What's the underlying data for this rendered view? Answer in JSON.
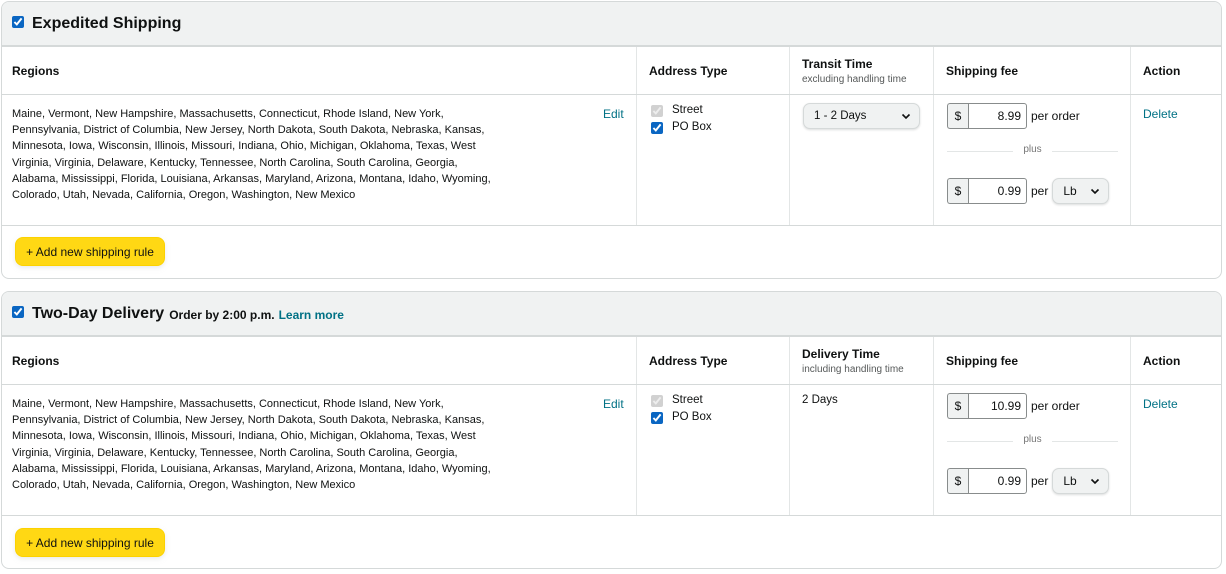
{
  "sections": [
    {
      "title": "Expedited Shipping",
      "subtitle": "",
      "link": "",
      "enabled": true,
      "headers": {
        "regions": "Regions",
        "address_type": "Address Type",
        "time": "Transit Time",
        "time_sub": "excluding handling time",
        "fee": "Shipping fee",
        "action": "Action"
      },
      "row": {
        "regions": "Maine, Vermont, New Hampshire, Massachusetts, Connecticut, Rhode Island, New York, Pennsylvania, District of Columbia, New Jersey, North Dakota, South Dakota, Nebraska, Kansas, Minnesota, Iowa, Wisconsin, Illinois, Missouri, Indiana, Ohio, Michigan, Oklahoma, Texas, West Virginia, Virginia, Delaware, Kentucky, Tennessee, North Carolina, South Carolina, Georgia, Alabama, Mississippi, Florida, Louisiana, Arkansas, Maryland, Arizona, Montana, Idaho, Wyoming, Colorado, Utah, Nevada, California, Oregon, Washington, New Mexico",
        "edit": "Edit",
        "street": "Street",
        "street_checked": true,
        "street_disabled": true,
        "po_box": "PO Box",
        "po_box_checked": true,
        "time_value": "1 - 2 Days",
        "currency": "$",
        "per_order_fee": "8.99",
        "per_order": "per order",
        "plus": "plus",
        "per_unit_fee": "0.99",
        "per": "per",
        "unit": "Lb",
        "delete": "Delete"
      },
      "add_rule": "+ Add new shipping rule"
    },
    {
      "title": "Two-Day Delivery",
      "subtitle": "Order by 2:00 p.m.",
      "link": "Learn more",
      "enabled": true,
      "headers": {
        "regions": "Regions",
        "address_type": "Address Type",
        "time": "Delivery Time",
        "time_sub": "including handling time",
        "fee": "Shipping fee",
        "action": "Action"
      },
      "row": {
        "regions": "Maine, Vermont, New Hampshire, Massachusetts, Connecticut, Rhode Island, New York, Pennsylvania, District of Columbia, New Jersey, North Dakota, South Dakota, Nebraska, Kansas, Minnesota, Iowa, Wisconsin, Illinois, Missouri, Indiana, Ohio, Michigan, Oklahoma, Texas, West Virginia, Virginia, Delaware, Kentucky, Tennessee, North Carolina, South Carolina, Georgia, Alabama, Mississippi, Florida, Louisiana, Arkansas, Maryland, Arizona, Montana, Idaho, Wyoming, Colorado, Utah, Nevada, California, Oregon, Washington, New Mexico",
        "edit": "Edit",
        "street": "Street",
        "street_checked": true,
        "street_disabled": true,
        "po_box": "PO Box",
        "po_box_checked": true,
        "time_value": "2 Days",
        "currency": "$",
        "per_order_fee": "10.99",
        "per_order": "per order",
        "plus": "plus",
        "per_unit_fee": "0.99",
        "per": "per",
        "unit": "Lb",
        "delete": "Delete"
      },
      "add_rule": "+ Add new shipping rule"
    }
  ],
  "colors": {
    "link": "#007185",
    "button_yellow": "#FFD814",
    "header_bg": "#F0F2F2",
    "checkbox": "#0A66C2"
  },
  "icons": {
    "select_arrow": "chevron-down-icon"
  }
}
